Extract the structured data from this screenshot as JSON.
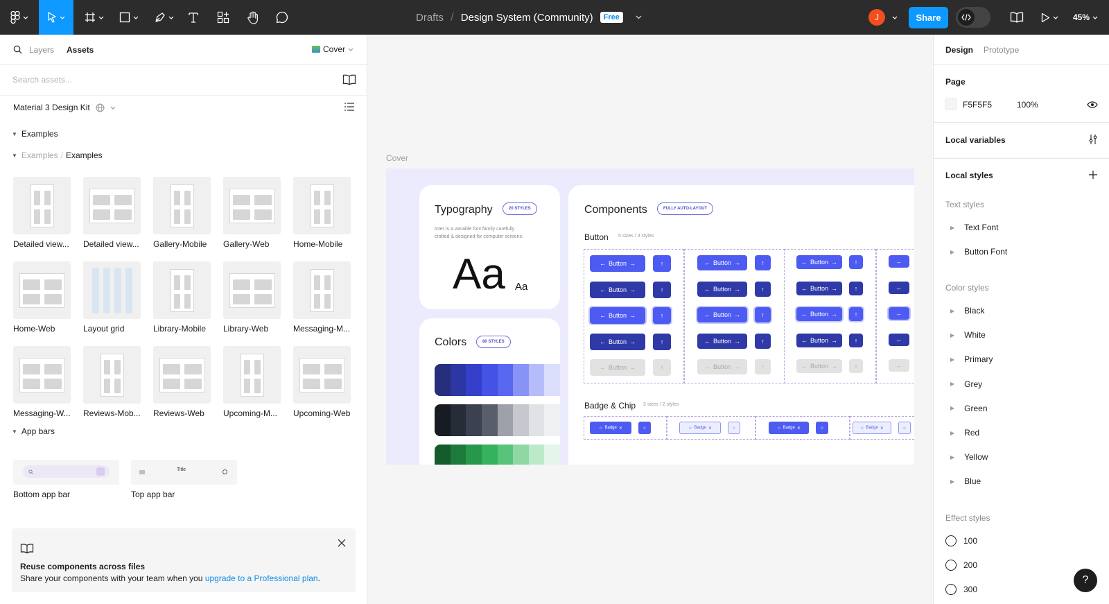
{
  "toolbar": {
    "breadcrumb": "Drafts",
    "separator": "/",
    "file_name": "Design System (Community)",
    "plan_badge": "Free",
    "avatar_initial": "J",
    "share_label": "Share",
    "zoom": "45%",
    "tools": [
      "main-menu-icon",
      "move-icon",
      "frame-icon",
      "rectangle-icon",
      "pen-icon",
      "text-icon",
      "resources-icon",
      "hand-icon",
      "comment-icon"
    ]
  },
  "left_panel": {
    "tabs": {
      "layers": "Layers",
      "assets": "Assets"
    },
    "page_selector": "Cover",
    "search_placeholder": "Search assets...",
    "library_name": "Material 3 Design Kit",
    "section_examples": "Examples",
    "subsection_parent": "Examples",
    "subsection_sep": "/",
    "subsection_name": "Examples",
    "thumbnails": [
      "Detailed view...",
      "Detailed view...",
      "Gallery-Mobile",
      "Gallery-Web",
      "Home-Mobile",
      "Home-Web",
      "Layout grid",
      "Library-Mobile",
      "Library-Web",
      "Messaging-M...",
      "Messaging-W...",
      "Reviews-Mob...",
      "Reviews-Web",
      "Upcoming-M...",
      "Upcoming-Web"
    ],
    "section_app_bars": "App bars",
    "app_bars": [
      "Bottom app bar",
      "Top app bar"
    ],
    "app_bar_thumb_title": "Title",
    "tip": {
      "title": "Reuse components across files",
      "text": "Share your components with your team when you ",
      "link": "upgrade to a Professional plan",
      "end": "."
    }
  },
  "canvas": {
    "frame_label": "Cover",
    "typography": {
      "title": "Typography",
      "badge": "20 STYLES",
      "desc1": "Inter is a variable font family carefully",
      "desc2": "crafted & designed for computer screens.",
      "big": "Aa",
      "small": "Aa"
    },
    "colors_card": {
      "title": "Colors",
      "badge": "80 STYLES",
      "rows": [
        [
          "#262e7d",
          "#2c37a4",
          "#3440cc",
          "#4452e6",
          "#5866f0",
          "#8993f5",
          "#b6bcf9",
          "#dcdffc"
        ],
        [
          "#161b24",
          "#262c38",
          "#3b4150",
          "#595e6b",
          "#9ea1a9",
          "#c6c8cd",
          "#e1e2e5",
          "#eff0f2"
        ],
        [
          "#155c2c",
          "#1e7a3b",
          "#27984b",
          "#36b25d",
          "#58c47b",
          "#8fd8a6",
          "#bde9cb",
          "#e3f6e9"
        ]
      ]
    },
    "components": {
      "title": "Components",
      "badge": "FULLY AUTO-LAYOUT",
      "button_title": "Button",
      "button_meta": "5 sizes / 3 styles",
      "button_label": "Button",
      "badge_title": "Badge & Chip",
      "badge_meta": "3 sizes / 2 styles",
      "badge_label": "Badge"
    }
  },
  "right_panel": {
    "tabs": {
      "design": "Design",
      "prototype": "Prototype"
    },
    "page_heading": "Page",
    "page_color": "F5F5F5",
    "page_opacity": "100%",
    "local_variables": "Local variables",
    "local_styles": "Local styles",
    "text_styles_heading": "Text styles",
    "text_styles": [
      "Text Font",
      "Button Font"
    ],
    "color_styles_heading": "Color styles",
    "color_styles": [
      "Black",
      "White",
      "Primary",
      "Grey",
      "Green",
      "Red",
      "Yellow",
      "Blue"
    ],
    "effect_styles_heading": "Effect styles",
    "effect_styles": [
      "100",
      "200",
      "300"
    ]
  },
  "colors": {
    "toolbar_bg": "#2c2c2c",
    "accent": "#0d99ff",
    "avatar": "#f24e1e",
    "button_primary": "#4e5bf2",
    "button_dark": "#2f3aa8"
  },
  "help_label": "?"
}
